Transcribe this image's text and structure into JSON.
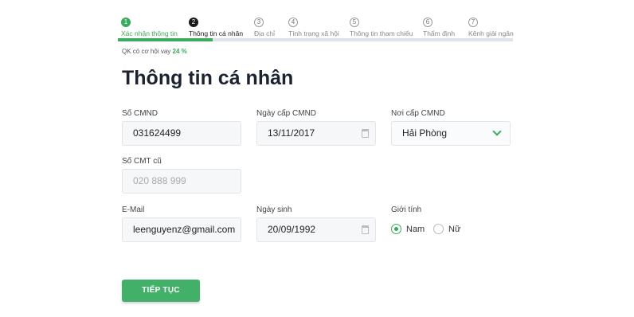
{
  "stepper": {
    "steps": [
      {
        "num": "1",
        "label": "Xác nhận thông tin",
        "state": "done"
      },
      {
        "num": "2",
        "label": "Thông tin cá nhân",
        "state": "active"
      },
      {
        "num": "3",
        "label": "Địa chỉ",
        "state": "pending"
      },
      {
        "num": "4",
        "label": "Tình trạng xã hội",
        "state": "pending"
      },
      {
        "num": "5",
        "label": "Thông tin tham chiếu",
        "state": "pending"
      },
      {
        "num": "6",
        "label": "Thẩm định",
        "state": "pending"
      },
      {
        "num": "7",
        "label": "Kênh giải ngân",
        "state": "pending"
      }
    ],
    "progress_fraction": 0.24
  },
  "chance": {
    "text": "QK có cơ hội vay",
    "percent": "24 %"
  },
  "page_title": "Thông tin cá nhân",
  "form": {
    "cmnd": {
      "label": "Số CMND",
      "value": "031624499"
    },
    "issue_date": {
      "label": "Ngày cấp CMND",
      "value": "13/11/2017"
    },
    "issue_place": {
      "label": "Nơi cấp CMND",
      "value": "Hải Phòng"
    },
    "old_cmt": {
      "label": "Số CMT cũ",
      "placeholder": "020 888 999"
    },
    "email": {
      "label": "E-Mail",
      "value": "leenguyenz@gmail.com"
    },
    "birth_date": {
      "label": "Ngày sinh",
      "value": "20/09/1992"
    },
    "gender": {
      "label": "Giới tính",
      "options": [
        "Nam",
        "Nữ"
      ],
      "selected": "Nam"
    }
  },
  "submit_label": "TIẾP TỤC",
  "colors": {
    "accent": "#3aaa5c",
    "button": "#43b06a"
  }
}
